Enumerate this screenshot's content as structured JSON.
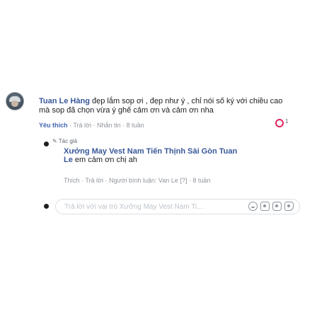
{
  "comment": {
    "author": "Tuan Le Hàng",
    "text": "đẹp lắm sop ơi , đẹp như ý , chỉ nói số ký với chiều cao mà sop đã chọn vừa ý ghế cảm ơn và cảm ơn nha",
    "actions": {
      "like": "Yêu thích",
      "reply": "Trả lời",
      "message": "Nhắn tin",
      "time": "8 tuần"
    },
    "reaction_count": "1"
  },
  "reply": {
    "author_tag": "Tác giả",
    "author": "Xưởng May Vest Nam Tiến Thịnh Sài Gòn",
    "mention": "Tuan Le",
    "text": "em cảm ơn chị ah",
    "actions": {
      "like": "Thích",
      "reply": "Trả lời",
      "commenter_label": "Người bình luận: Van Le",
      "time": "8 tuần"
    }
  },
  "composer": {
    "placeholder": "Trả lời với vai trò Xưởng May Vest Nam Ti..."
  },
  "colors": {
    "link": "#385898",
    "reaction": "#e0245e",
    "meta": "#90949c"
  },
  "icons": [
    "emoji-icon",
    "camera-icon",
    "gif-icon",
    "sticker-icon"
  ]
}
